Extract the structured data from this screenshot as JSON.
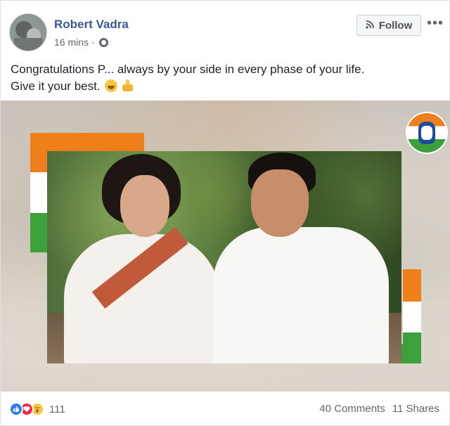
{
  "post": {
    "author": "Robert Vadra",
    "time": "16 mins",
    "separator": "·",
    "follow_label": "Follow",
    "more_label": "•••",
    "text_line1": "Congratulations P... always by your side in every phase of your life.",
    "text_line2": "Give it your best.",
    "emojis": [
      "smile-icon",
      "thumbs-up-icon"
    ]
  },
  "footer": {
    "reaction_icons": [
      "like-icon",
      "love-icon",
      "wow-icon"
    ],
    "reaction_count": "111",
    "comments": "40 Comments",
    "shares": "11 Shares"
  },
  "colors": {
    "link": "#385898",
    "saffron": "#ef7f1a",
    "green": "#3ca13a",
    "like_blue": "#2e7cf6",
    "love_red": "#f0284a"
  }
}
